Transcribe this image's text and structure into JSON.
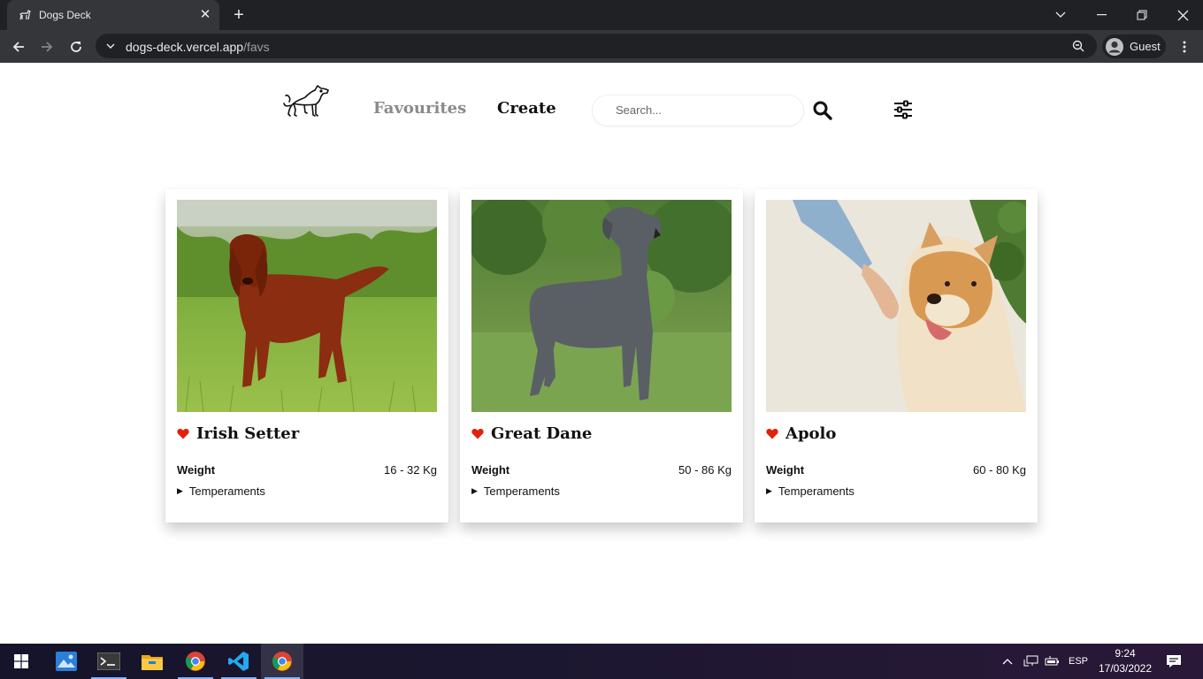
{
  "browser": {
    "tab_title": "Dogs Deck",
    "url_host": "dogs-deck.vercel.app",
    "url_path": "/favs",
    "profile_label": "Guest"
  },
  "site": {
    "nav": {
      "favourites_label": "Favourites",
      "create_label": "Create"
    },
    "search": {
      "placeholder": "Search..."
    },
    "colors": {
      "heart": "#e3210b",
      "favourites_active": "#8a8a8a"
    }
  },
  "cards": [
    {
      "name": "Irish Setter",
      "weight_label": "Weight",
      "weight_value": "16 - 32 Kg",
      "temperaments_label": "Temperaments",
      "image": "irish-setter-photo"
    },
    {
      "name": "Great Dane",
      "weight_label": "Weight",
      "weight_value": "50 - 86 Kg",
      "temperaments_label": "Temperaments",
      "image": "great-dane-photo"
    },
    {
      "name": "Apolo",
      "weight_label": "Weight",
      "weight_value": "60 - 80 Kg",
      "temperaments_label": "Temperaments",
      "image": "akita-photo"
    }
  ],
  "taskbar": {
    "lang": "ESP",
    "time": "9:24",
    "date": "17/03/2022"
  }
}
